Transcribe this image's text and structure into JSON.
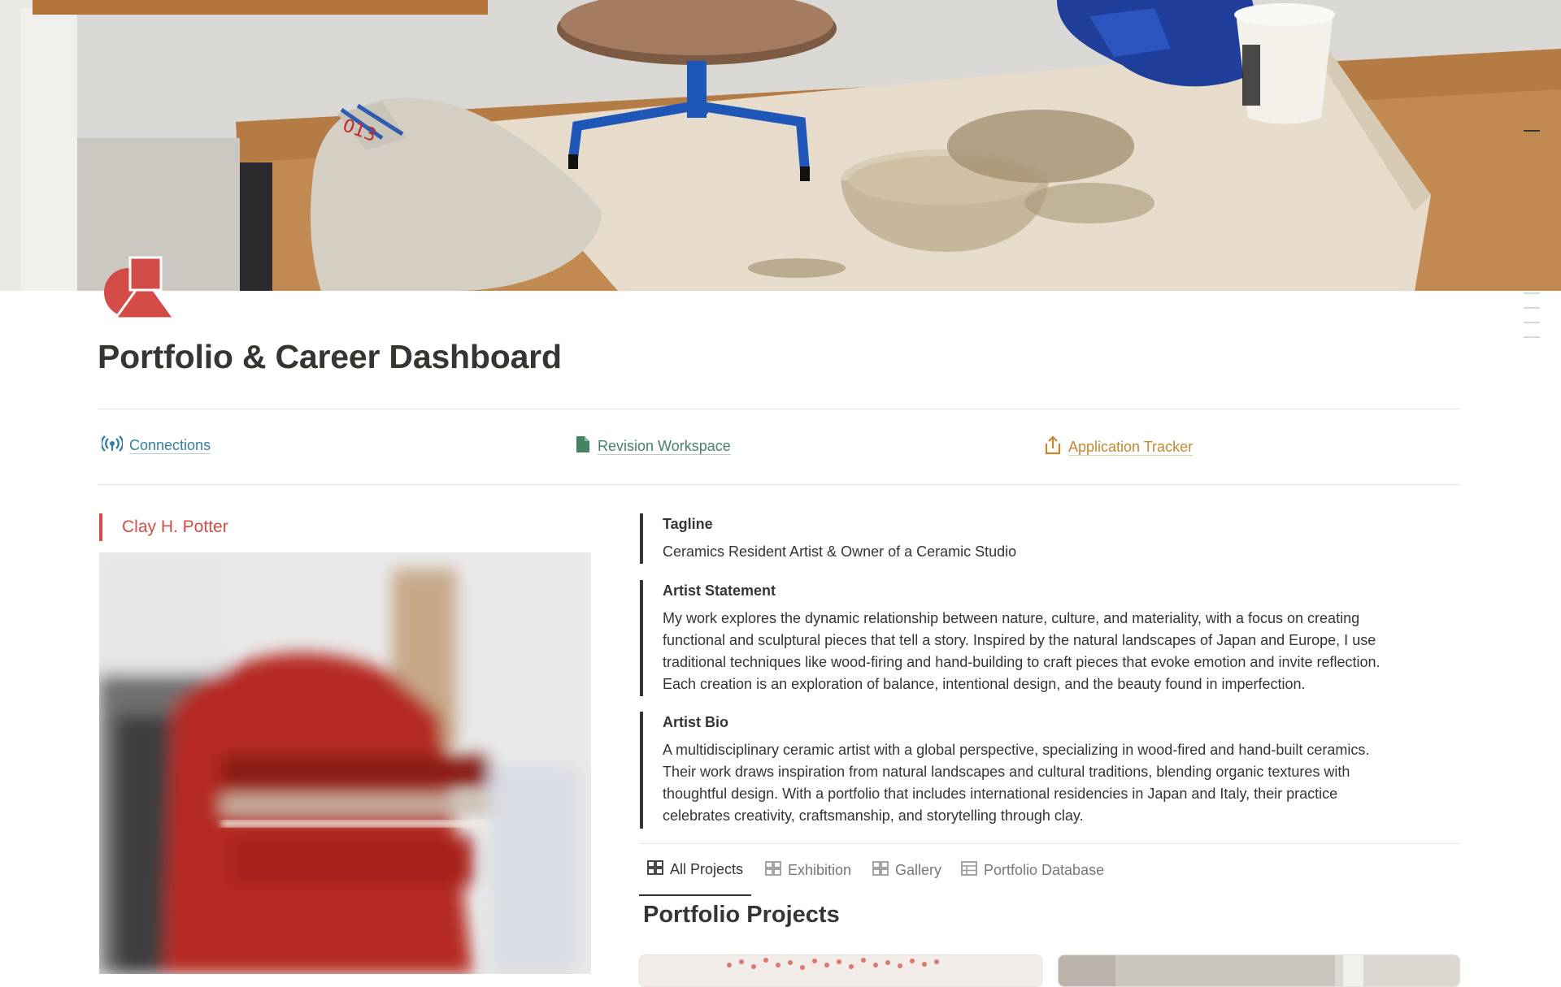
{
  "page": {
    "title": "Portfolio & Career Dashboard",
    "cover_description_icon": "cover-image",
    "page_icon": "shapes-icon"
  },
  "links": [
    {
      "label": "Connections",
      "icon": "broadcast-icon",
      "color": "#337ea9"
    },
    {
      "label": "Revision Workspace",
      "icon": "document-icon",
      "color": "#448361"
    },
    {
      "label": "Application Tracker",
      "icon": "share-upload-icon",
      "color": "#c4882e"
    }
  ],
  "artist": {
    "name": "Clay H. Potter"
  },
  "callouts": {
    "tagline": {
      "heading": "Tagline",
      "text": "Ceramics Resident Artist & Owner of a Ceramic Studio"
    },
    "statement": {
      "heading": "Artist Statement",
      "lines": [
        "My work explores the dynamic relationship between nature, culture, and materiality, with a focus on creating",
        "functional and sculptural pieces that tell a story. Inspired by the natural landscapes of Japan and Europe, I use",
        "traditional techniques like wood-firing and hand-building to craft pieces that evoke emotion and invite reflection.",
        "Each creation is an exploration of balance, intentional design, and the beauty found in imperfection."
      ]
    },
    "bio": {
      "heading": "Artist Bio",
      "lines": [
        "A multidisciplinary ceramic artist with a global perspective, specializing in wood-fired and hand-built ceramics.",
        "Their work draws inspiration from natural landscapes and cultural traditions, blending organic textures with",
        "thoughtful design. With a portfolio that includes international residencies in Japan and Italy, their practice",
        "celebrates creativity, craftsmanship, and storytelling through clay."
      ]
    }
  },
  "tabs": [
    {
      "label": "All Projects",
      "icon": "gallery-icon",
      "active": true
    },
    {
      "label": "Exhibition",
      "icon": "gallery-icon",
      "active": false
    },
    {
      "label": "Gallery",
      "icon": "gallery-icon",
      "active": false
    },
    {
      "label": "Portfolio Database",
      "icon": "table-icon",
      "active": false
    }
  ],
  "database": {
    "title": "Portfolio Projects"
  },
  "colors": {
    "accent_red": "#d44c47",
    "text": "#37352f",
    "muted": "#787774",
    "blue": "#337ea9",
    "green": "#448361",
    "orange": "#c4882e"
  }
}
